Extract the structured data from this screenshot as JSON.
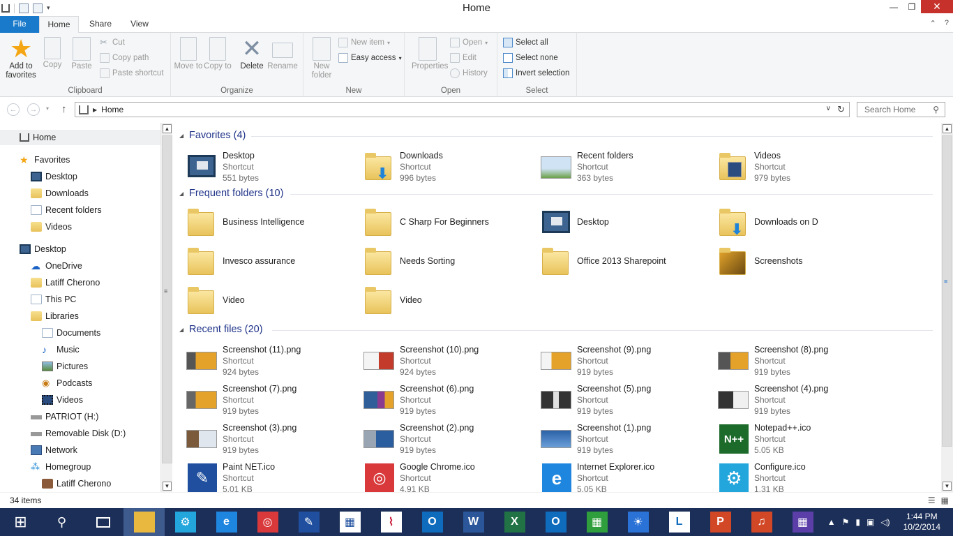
{
  "window": {
    "title": "Home"
  },
  "window_controls": {
    "minimize": "—",
    "maximize": "❐",
    "close": "✕"
  },
  "ribbon_tabs": {
    "file": "File",
    "home": "Home",
    "share": "Share",
    "view": "View"
  },
  "ribbon_right": {
    "collapse": "⌃",
    "help": "?"
  },
  "clipboard": {
    "label": "Clipboard",
    "add_to_favorites": "Add to favorites",
    "copy": "Copy",
    "paste": "Paste",
    "cut": "Cut",
    "copy_path": "Copy path",
    "paste_shortcut": "Paste shortcut"
  },
  "organize": {
    "label": "Organize",
    "move_to": "Move to",
    "copy_to": "Copy to",
    "delete": "Delete",
    "rename": "Rename"
  },
  "new_group": {
    "label": "New",
    "new_folder": "New folder",
    "new_item": "New item",
    "easy_access": "Easy access"
  },
  "open_group": {
    "label": "Open",
    "properties": "Properties",
    "open": "Open",
    "edit": "Edit",
    "history": "History"
  },
  "select_group": {
    "label": "Select",
    "select_all": "Select all",
    "select_none": "Select none",
    "invert_selection": "Invert selection"
  },
  "address": {
    "path": "Home",
    "search_placeholder": "Search Home"
  },
  "nav_pane": [
    "Home",
    "Favorites",
    "Desktop",
    "Downloads",
    "Recent folders",
    "Videos",
    "Desktop",
    "OneDrive",
    "Latiff Cherono",
    "This PC",
    "Libraries",
    "Documents",
    "Music",
    "Pictures",
    "Podcasts",
    "Videos",
    "PATRIOT (H:)",
    "Removable Disk (D:)",
    "Network",
    "Homegroup",
    "Latiff Cherono"
  ],
  "sections": {
    "favorites": "Favorites (4)",
    "frequent": "Frequent folders (10)",
    "recent": "Recent files (20)"
  },
  "favorites": [
    {
      "name": "Desktop",
      "type": "Shortcut",
      "size": "551 bytes"
    },
    {
      "name": "Downloads",
      "type": "Shortcut",
      "size": "996 bytes"
    },
    {
      "name": "Recent folders",
      "type": "Shortcut",
      "size": "363 bytes"
    },
    {
      "name": "Videos",
      "type": "Shortcut",
      "size": "979 bytes"
    }
  ],
  "frequent": [
    "Business Intelligence",
    "C Sharp For Beginners",
    "Desktop",
    "Downloads on D",
    "Invesco assurance",
    "Needs Sorting",
    "Office 2013 Sharepoint",
    "Screenshots",
    "Video",
    "Video"
  ],
  "recent": [
    {
      "name": "Screenshot (11).png",
      "type": "Shortcut",
      "size": "924 bytes"
    },
    {
      "name": "Screenshot (10).png",
      "type": "Shortcut",
      "size": "924 bytes"
    },
    {
      "name": "Screenshot (9).png",
      "type": "Shortcut",
      "size": "919 bytes"
    },
    {
      "name": "Screenshot (8).png",
      "type": "Shortcut",
      "size": "919 bytes"
    },
    {
      "name": "Screenshot (7).png",
      "type": "Shortcut",
      "size": "919 bytes"
    },
    {
      "name": "Screenshot (6).png",
      "type": "Shortcut",
      "size": "919 bytes"
    },
    {
      "name": "Screenshot (5).png",
      "type": "Shortcut",
      "size": "919 bytes"
    },
    {
      "name": "Screenshot (4).png",
      "type": "Shortcut",
      "size": "919 bytes"
    },
    {
      "name": "Screenshot (3).png",
      "type": "Shortcut",
      "size": "919 bytes"
    },
    {
      "name": "Screenshot (2).png",
      "type": "Shortcut",
      "size": "919 bytes"
    },
    {
      "name": "Screenshot (1).png",
      "type": "Shortcut",
      "size": "919 bytes"
    },
    {
      "name": "Notepad++.ico",
      "type": "Shortcut",
      "size": "5.05 KB"
    },
    {
      "name": "Paint NET.ico",
      "type": "Shortcut",
      "size": "5.01 KB"
    },
    {
      "name": "Google Chrome.ico",
      "type": "Shortcut",
      "size": "4.91 KB"
    },
    {
      "name": "Internet Explorer.ico",
      "type": "Shortcut",
      "size": "5.05 KB"
    },
    {
      "name": "Configure.ico",
      "type": "Shortcut",
      "size": "1.31 KB"
    }
  ],
  "status": {
    "items": "34 items"
  },
  "clock": {
    "time": "1:44 PM",
    "date": "10/2/2014"
  },
  "colors": {
    "accent": "#1979ca",
    "taskbar": "#1c2f58",
    "section_title": "#1e3287"
  }
}
